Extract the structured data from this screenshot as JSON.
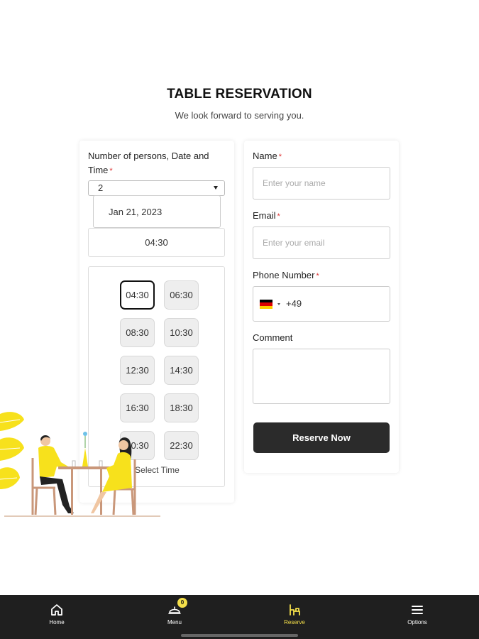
{
  "page": {
    "title": "TABLE RESERVATION",
    "subtitle": "We look forward to serving you."
  },
  "reservation": {
    "label_line1": "Number of persons, Date and",
    "label_line2": "Time",
    "required_mark": "*",
    "persons": "2",
    "date": "Jan 21, 2023",
    "time": "04:30",
    "slots_caption": "Select Time",
    "selected_slot": "04:30",
    "slots": [
      "04:30",
      "06:30",
      "08:30",
      "10:30",
      "12:30",
      "14:30",
      "16:30",
      "18:30",
      "20:30",
      "22:30"
    ]
  },
  "form": {
    "name_label": "Name",
    "name_placeholder": "Enter your name",
    "email_label": "Email",
    "email_placeholder": "Enter your email",
    "phone_label": "Phone Number",
    "phone_code": "+49",
    "phone_country_flag": "germany-flag",
    "comment_label": "Comment",
    "submit_label": "Reserve Now",
    "required_mark": "*"
  },
  "navbar": {
    "items": [
      {
        "label": "Home",
        "icon": "home-icon"
      },
      {
        "label": "Menu",
        "icon": "cloche-icon",
        "badge": "0"
      },
      {
        "label": "Reserve",
        "icon": "reserve-icon",
        "active": true
      },
      {
        "label": "Options",
        "icon": "hamburger-icon"
      }
    ]
  },
  "colors": {
    "accent": "#f5e04a",
    "button": "#2b2b2b",
    "navbar": "#1f1f1f",
    "required": "#dd3333"
  }
}
